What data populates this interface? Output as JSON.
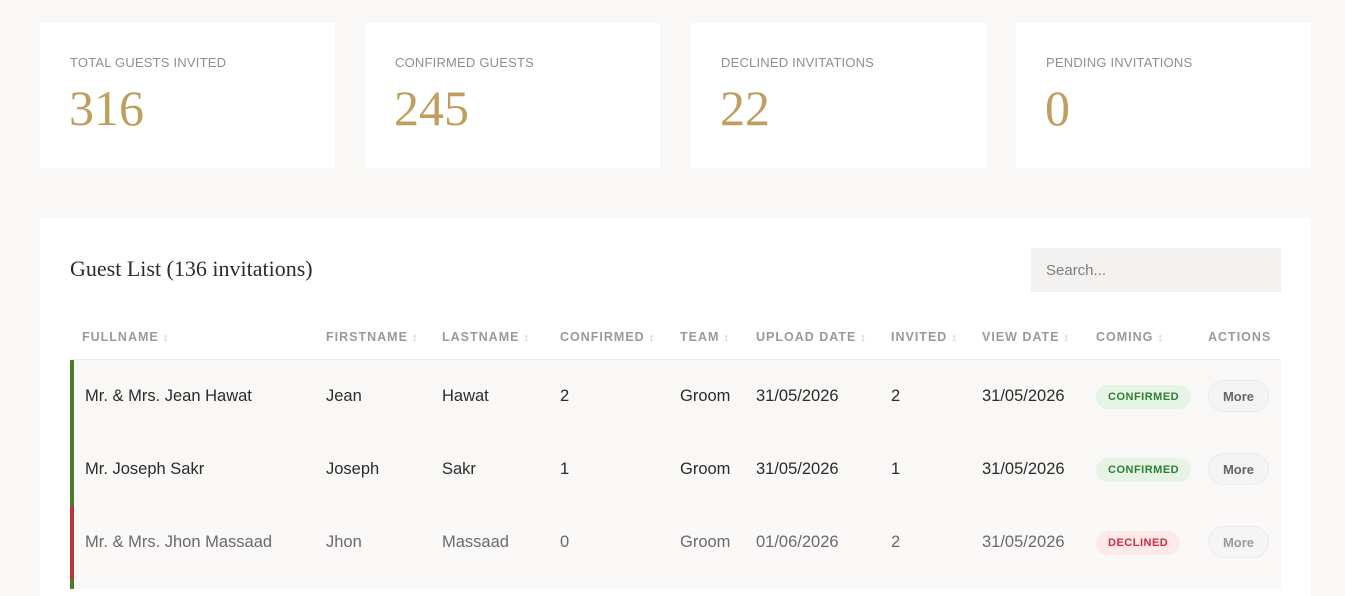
{
  "stats": [
    {
      "label": "TOTAL GUESTS INVITED",
      "value": "316"
    },
    {
      "label": "CONFIRMED GUESTS",
      "value": "245"
    },
    {
      "label": "DECLINED INVITATIONS",
      "value": "22"
    },
    {
      "label": "PENDING INVITATIONS",
      "value": "0"
    }
  ],
  "guest_list": {
    "title": "Guest List (136 invitations)",
    "search_placeholder": "Search...",
    "columns": [
      "FULLNAME",
      "FIRSTNAME",
      "LASTNAME",
      "CONFIRMED",
      "TEAM",
      "UPLOAD DATE",
      "INVITED",
      "VIEW DATE",
      "COMING",
      "ACTIONS"
    ],
    "sort_icon": "↕",
    "rows": [
      {
        "fullname": "Mr. & Mrs. Jean Hawat",
        "firstname": "Jean",
        "lastname": "Hawat",
        "confirmed": "2",
        "team": "Groom",
        "upload_date": "31/05/2026",
        "invited": "2",
        "view_date": "31/05/2026",
        "coming": "CONFIRMED",
        "action": "More"
      },
      {
        "fullname": "Mr. Joseph Sakr",
        "firstname": "Joseph",
        "lastname": "Sakr",
        "confirmed": "1",
        "team": "Groom",
        "upload_date": "31/05/2026",
        "invited": "1",
        "view_date": "31/05/2026",
        "coming": "CONFIRMED",
        "action": "More"
      },
      {
        "fullname": "Mr. & Mrs. Jhon Massaad",
        "firstname": "Jhon",
        "lastname": "Massaad",
        "confirmed": "0",
        "team": "Groom",
        "upload_date": "01/06/2026",
        "invited": "2",
        "view_date": "31/05/2026",
        "coming": "DECLINED",
        "action": "More"
      }
    ]
  },
  "colors": {
    "accent_gold": "#bf9e5e",
    "confirmed_bar": "#4f7a2b",
    "declined_bar": "#b8363b",
    "badge_confirmed_text": "#2f7d32",
    "badge_declined_text": "#d12d3c"
  }
}
